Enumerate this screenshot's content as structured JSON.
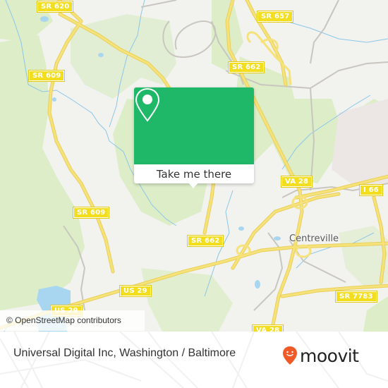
{
  "map": {
    "place_labels": [
      {
        "name": "centreville",
        "text": "Centreville"
      }
    ],
    "road_shields": [
      {
        "id": "sr620",
        "text": "SR 620"
      },
      {
        "id": "sr657",
        "text": "SR 657"
      },
      {
        "id": "sr662-top",
        "text": "SR 662"
      },
      {
        "id": "sr609-top",
        "text": "SR 609"
      },
      {
        "id": "va28-top",
        "text": "VA 28"
      },
      {
        "id": "i66",
        "text": "I 66"
      },
      {
        "id": "sr609-mid",
        "text": "SR 609"
      },
      {
        "id": "sr662-mid",
        "text": "SR 662"
      },
      {
        "id": "us29-right",
        "text": "US 29"
      },
      {
        "id": "us29-left",
        "text": "US 29"
      },
      {
        "id": "sr7783",
        "text": "SR 7783"
      },
      {
        "id": "va28-bottom",
        "text": "VA 28"
      }
    ],
    "attribution": "© OpenStreetMap contributors",
    "colors": {
      "land": "#f2f2ef",
      "forest": "#dcedc8",
      "water": "#a8d6f0",
      "major_road": "#f6e27a",
      "minor_road": "#c9c6c0",
      "urban": "#ece6e4"
    }
  },
  "popup": {
    "icon": "location-pin-icon",
    "button_label": "Take me there",
    "color": "#1fb868"
  },
  "footer": {
    "title": "Universal Digital Inc, Washington / Baltimore",
    "brand": "moovit",
    "brand_color": "#f05a28"
  }
}
